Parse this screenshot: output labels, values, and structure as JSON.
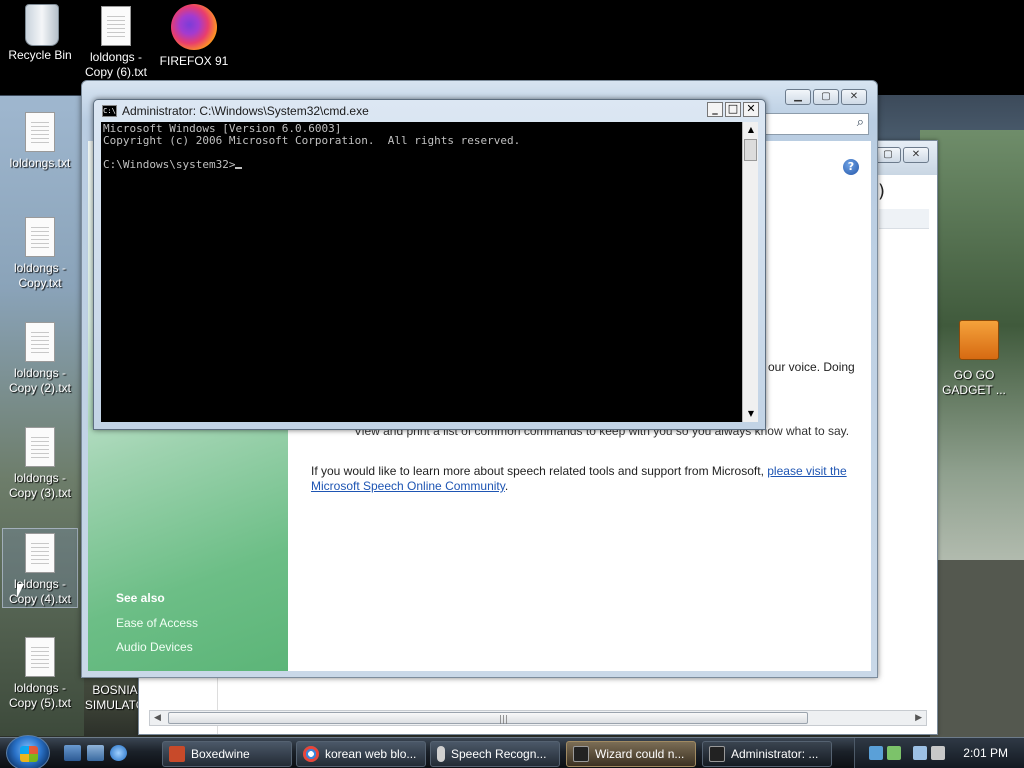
{
  "desktop": {
    "icons": [
      {
        "label": "Recycle Bin"
      },
      {
        "label": "loldongs - Copy (6).txt"
      },
      {
        "label": "FIREFOX 91"
      },
      {
        "label": "loldongs.txt"
      },
      {
        "label": "loldongs - Copy.txt"
      },
      {
        "label": "loldongs - Copy (2).txt"
      },
      {
        "label": "loldongs - Copy (3).txt"
      },
      {
        "label": "loldongs - Copy (4).txt"
      },
      {
        "label": "loldongs - Copy (5).txt"
      },
      {
        "label": "BOSNIA SIMULATO"
      },
      {
        "label": "GO GO GADGET ..."
      }
    ]
  },
  "cmd": {
    "title": "Administrator: C:\\Windows\\System32\\cmd.exe",
    "icon_text": "C:\\",
    "lines": [
      "Microsoft Windows [Version 6.0.6003]",
      "Copyright (c) 2006 Microsoft Corporation.  All rights reserved.",
      "",
      "C:\\Windows\\system32>"
    ],
    "minimize": "_",
    "maximize": "□",
    "close": "✕"
  },
  "speech_window": {
    "help_glyph": "?",
    "text_voice": "our voice.  Doing",
    "text_commands": "View and print a list of common commands to keep with you so you always know what to say.",
    "text_learn": "If you would like to learn more about speech related tools and support from Microsoft,",
    "link_part1": "please visit the",
    "link_part2": "Microsoft Speech Online Community",
    "link_period": ".",
    "see_also": "See also",
    "links": [
      "Ease of Access",
      "Audio Devices"
    ],
    "search_icon": "search-icon"
  },
  "back_window": {
    "paren": ")"
  },
  "taskbar": {
    "buttons": [
      {
        "label": "Boxedwine",
        "icon": "boxedwine-icon",
        "color": "#c84a2a"
      },
      {
        "label": "korean web blo...",
        "icon": "chrome-icon",
        "color": "#3c84d8"
      },
      {
        "label": "Speech Recogn...",
        "icon": "microphone-icon",
        "color": "#d0d0d0"
      },
      {
        "label": "Wizard could n...",
        "icon": "cmd-icon",
        "color": "#222222"
      },
      {
        "label": "Administrator: ...",
        "icon": "cmd-icon",
        "color": "#222222"
      }
    ],
    "clock": "2:01 PM"
  },
  "colors": {
    "link": "#1e55b3",
    "cmd_bg": "#000000",
    "cmd_fg": "#c0c0c0",
    "sidebar_green": "#5cb578"
  }
}
